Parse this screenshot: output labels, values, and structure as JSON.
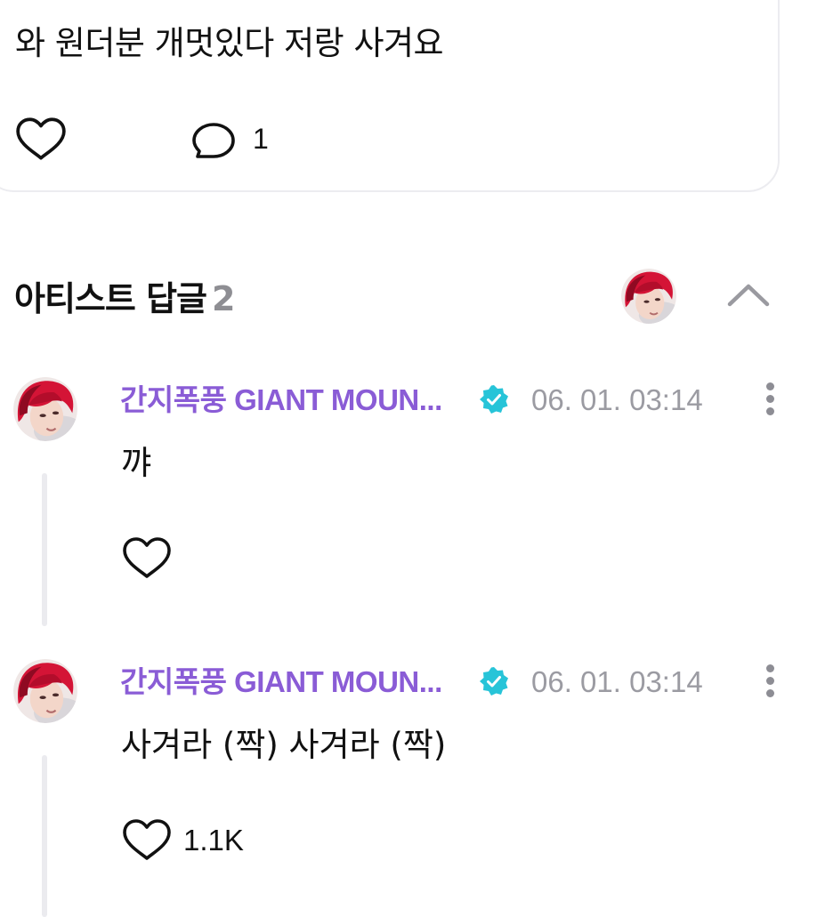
{
  "post": {
    "text": "와 원더분 개멋있다 저랑 사겨요",
    "reply_count": "1"
  },
  "artist_replies": {
    "title": "아티스트 답글",
    "count": "2"
  },
  "replies": [
    {
      "author": "간지폭풍 GIANT MOUN...",
      "timestamp": "06. 01. 03:14",
      "text": "꺄",
      "like_count": ""
    },
    {
      "author": "간지폭풍 GIANT MOUN...",
      "timestamp": "06. 01. 03:14",
      "text": "사겨라 (짝) 사겨라 (짝)",
      "like_count": "1.1K"
    }
  ],
  "icons": {
    "like": "heart-outline-icon",
    "reply": "speech-bubble-icon",
    "verified": "verified-badge-icon",
    "collapse": "chevron-up-icon",
    "more": "vertical-ellipsis-icon"
  },
  "colors": {
    "author_name": "#8a5cd6",
    "verified_badge": "#27c4d8",
    "timestamp": "#9b9ba2",
    "section_count": "#8e8e93",
    "thread_line": "#ebebef",
    "avatar_hair": "#d41436"
  }
}
